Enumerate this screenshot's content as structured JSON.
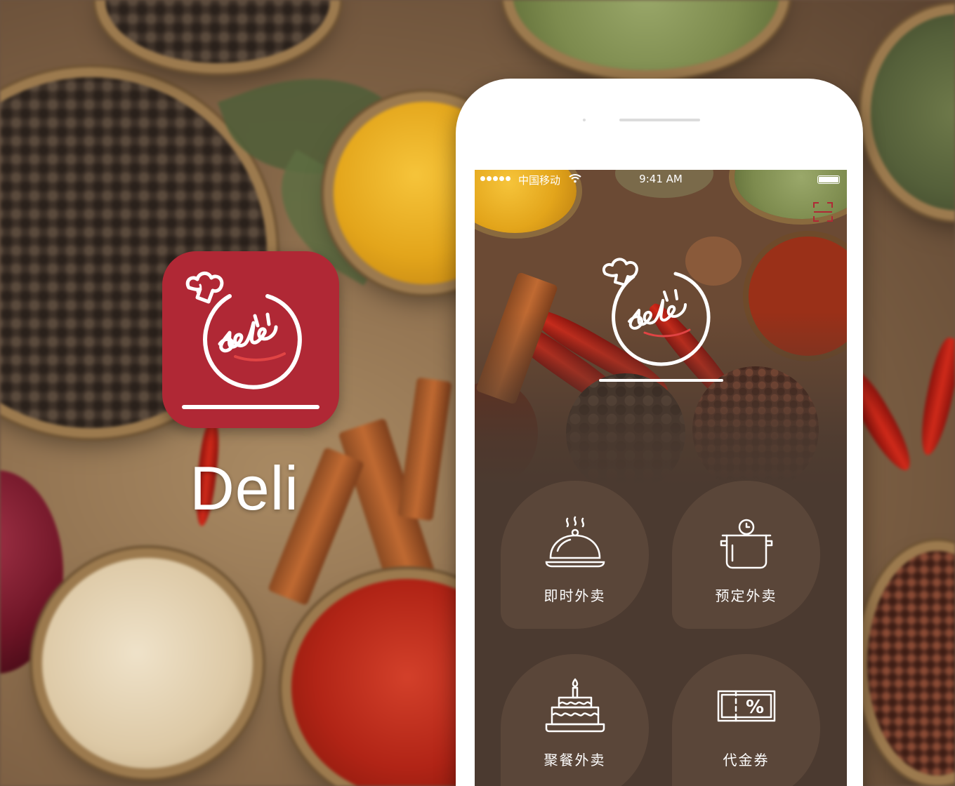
{
  "app": {
    "name": "Deli"
  },
  "statusbar": {
    "carrier": "中国移动",
    "time": "9:41 AM"
  },
  "menu": [
    {
      "label": "即时外卖",
      "icon": "cloche-icon"
    },
    {
      "label": "预定外卖",
      "icon": "pot-clock-icon"
    },
    {
      "label": "聚餐外卖",
      "icon": "cake-icon"
    },
    {
      "label": "代金券",
      "icon": "coupon-icon"
    }
  ],
  "colors": {
    "brand": "#b02835",
    "tile": "#5a4639",
    "screen": "#4b3a30"
  }
}
